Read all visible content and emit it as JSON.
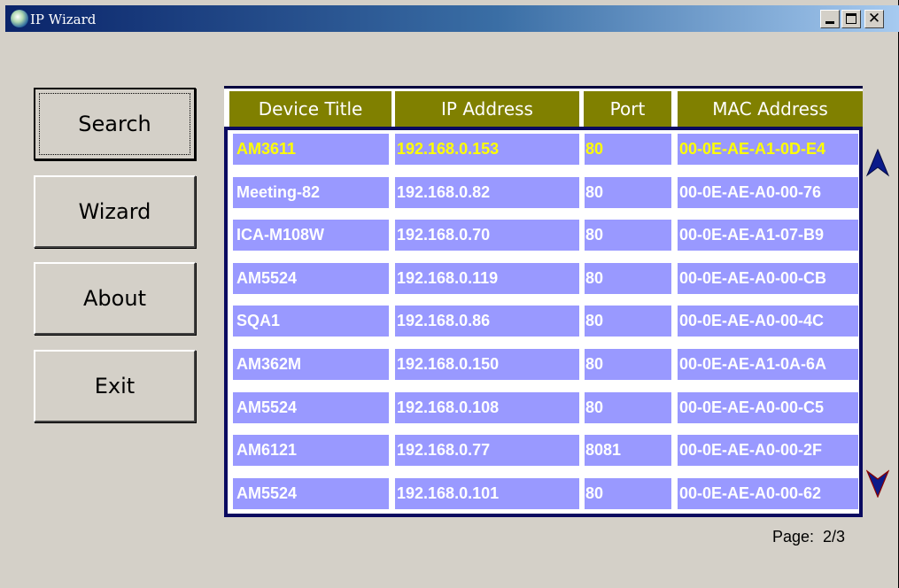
{
  "window": {
    "title": "IP Wizard"
  },
  "sidebar": {
    "buttons": [
      {
        "label": "Search"
      },
      {
        "label": "Wizard"
      },
      {
        "label": "About"
      },
      {
        "label": "Exit"
      }
    ]
  },
  "table": {
    "columns": [
      "Device Title",
      "IP Address",
      "Port",
      "MAC Address"
    ],
    "selected_row_index": 0,
    "rows": [
      [
        "AM3611",
        "192.168.0.153",
        "80",
        "00-0E-AE-A1-0D-E4"
      ],
      [
        "Meeting-82",
        "192.168.0.82",
        "80",
        "00-0E-AE-A0-00-76"
      ],
      [
        "ICA-M108W",
        "192.168.0.70",
        "80",
        "00-0E-AE-A1-07-B9"
      ],
      [
        "AM5524",
        "192.168.0.119",
        "80",
        "00-0E-AE-A0-00-CB"
      ],
      [
        "SQA1",
        "192.168.0.86",
        "80",
        "00-0E-AE-A0-00-4C"
      ],
      [
        "AM362M",
        "192.168.0.150",
        "80",
        "00-0E-AE-A1-0A-6A"
      ],
      [
        "AM5524",
        "192.168.0.108",
        "80",
        "00-0E-AE-A0-00-C5"
      ],
      [
        "AM6121",
        "192.168.0.77",
        "8081",
        "00-0E-AE-A0-00-2F"
      ],
      [
        "AM5524",
        "192.168.0.101",
        "80",
        "00-0E-AE-A0-00-62"
      ]
    ]
  },
  "pagination": {
    "label": "Page:",
    "value": "2/3"
  },
  "icons": {
    "app": "globe-icon",
    "scroll_up": "arrow-up-icon",
    "scroll_down": "arrow-down-icon"
  },
  "colors": {
    "header_bg": "#808000",
    "row_bg": "#9999ff",
    "selected_text": "#ffff00",
    "row_text": "#ffffff",
    "arrow": "#0a1a8a"
  }
}
